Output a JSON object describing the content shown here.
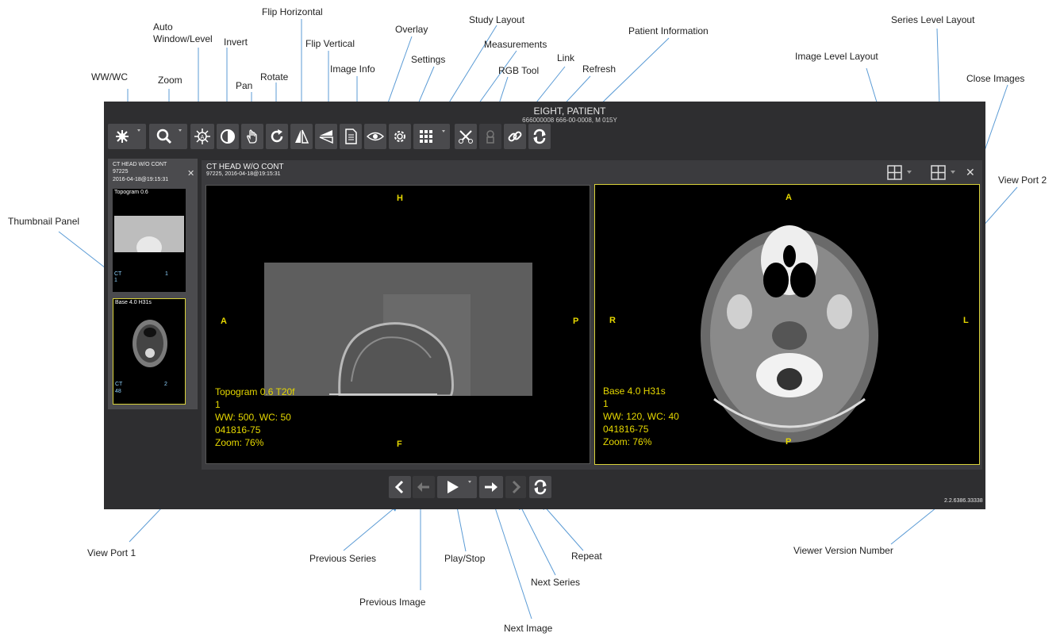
{
  "annotations": {
    "ww_wc": "WW/WC",
    "zoom": "Zoom",
    "auto_window_level_1": "Auto",
    "auto_window_level_2": "Window/Level",
    "invert": "Invert",
    "pan": "Pan",
    "rotate": "Rotate",
    "flip_horizontal": "Flip Horizontal",
    "flip_vertical": "Flip Vertical",
    "image_info": "Image Info",
    "overlay": "Overlay",
    "settings": "Settings",
    "study_layout": "Study Layout",
    "measurements": "Measurements",
    "rgb_tool": "RGB Tool",
    "link": "Link",
    "refresh": "Refresh",
    "patient_information": "Patient Information",
    "image_level_layout": "Image Level Layout",
    "series_level_layout": "Series Level Layout",
    "close_images": "Close Images",
    "view_port_2": "View Port 2",
    "thumbnail_panel": "Thumbnail Panel",
    "view_port_1": "View Port 1",
    "previous_series": "Previous Series",
    "previous_image": "Previous Image",
    "play_stop": "Play/Stop",
    "next_image": "Next Image",
    "next_series": "Next Series",
    "repeat": "Repeat",
    "viewer_version_number": "Viewer Version Number"
  },
  "patient": {
    "name": "EIGHT, PATIENT",
    "info": "666000008 666-00-0008, M 015Y"
  },
  "thumbnail_panel": {
    "study_title": "CT HEAD W/O CONT",
    "study_id": "97225",
    "study_date": "2016-04-18@19:15:31",
    "thumbs": [
      {
        "label": "Topogram 0.6",
        "modality": "CT",
        "count": "1",
        "index": "1"
      },
      {
        "label": "Base 4.0 H31s",
        "modality": "CT",
        "count": "48",
        "index": "2"
      }
    ]
  },
  "study": {
    "title": "CT HEAD W/O CONT",
    "subtitle": "97225, 2016-04-18@19:15:31"
  },
  "viewport1": {
    "orient_top": "H",
    "orient_left": "A",
    "orient_right": "P",
    "orient_bottom": "F",
    "overlay": [
      "Topogram  0.6  T20f",
      "1",
      "WW: 500, WC: 50",
      "041816-75",
      "Zoom: 76%"
    ]
  },
  "viewport2": {
    "orient_top": "A",
    "orient_left": "R",
    "orient_right": "L",
    "orient_bottom": "P",
    "overlay": [
      "Base  4.0  H31s",
      "1",
      "WW: 120, WC: 40",
      "041816-75",
      "Zoom: 76%"
    ]
  },
  "version": "2.2.6386.33338",
  "icons": {
    "toolbar": [
      "sun-icon",
      "magnifier-icon",
      "auto-window-icon",
      "invert-icon",
      "hand-icon",
      "rotate-icon",
      "flip-horizontal-icon",
      "flip-vertical-icon",
      "document-icon",
      "eye-icon",
      "gear-icon",
      "grid-icon",
      "measure-icon",
      "rgb-icon",
      "link-icon",
      "refresh-icon"
    ],
    "playback": [
      "chevron-left-icon",
      "arrow-left-icon",
      "play-icon",
      "arrow-right-icon",
      "chevron-right-icon",
      "repeat-icon"
    ]
  },
  "colors": {
    "annotation_arrow": "#5b9bd5",
    "overlay_text": "#e6d800",
    "active_viewport_border": "#d9d23a"
  }
}
